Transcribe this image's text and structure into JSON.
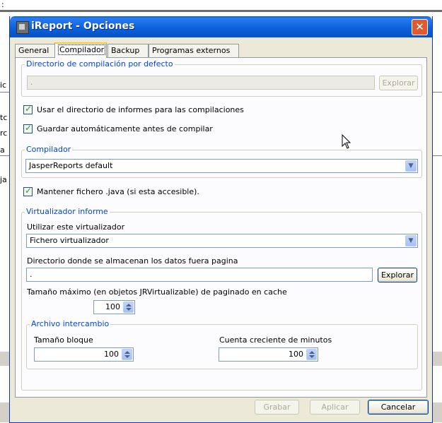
{
  "window": {
    "title": "iReport - Opciones",
    "title_icon": "ireport-app-icon",
    "close_icon": "close-icon"
  },
  "background_fragments": [
    ":",
    "ic",
    "tc",
    "rc",
    "a",
    "ja"
  ],
  "tabs": [
    {
      "label": "General",
      "active": false
    },
    {
      "label": "Compilador",
      "active": true
    },
    {
      "label": "Backup",
      "active": false
    },
    {
      "label": "Programas externos",
      "active": false
    }
  ],
  "compile_dir": {
    "legend": "Directorio de compilación por defecto",
    "value": ".",
    "browse_label": "Explorar"
  },
  "checkboxes": {
    "use_reports_dir": {
      "label": "Usar el directorio de informes para las compilaciones",
      "checked": true
    },
    "autosave": {
      "label": "Guardar automáticamente antes de compilar",
      "checked": true
    },
    "keep_java": {
      "label": "Mantener fichero .java (si esta accesible).",
      "checked": true
    }
  },
  "compiler": {
    "legend": "Compilador",
    "selected": "JasperReports default"
  },
  "virtualizer": {
    "legend": "Virtualizador informe",
    "use_label": "Utilizar este virtualizador",
    "selected": "Fichero virtualizador",
    "dir_label": "Directorio donde se almacenan los datos fuera pagina",
    "dir_value": ".",
    "browse_label": "Explorar",
    "max_label": "Tamaño máximo (en objetos JRVirtualizable) de paginado en cache",
    "max_value": "100",
    "swap": {
      "legend": "Archivo intercambio",
      "block_label": "Tamaño bloque",
      "block_value": "100",
      "growth_label": "Cuenta creciente de minutos",
      "growth_value": "100"
    }
  },
  "footer": {
    "save_label": "Grabar",
    "apply_label": "Aplicar",
    "cancel_label": "Cancelar"
  },
  "colors": {
    "titlebar": "#0a5fd9",
    "legend_text": "#0046d5",
    "check_green": "#21a121",
    "dialog_bg": "#ece9d8"
  }
}
